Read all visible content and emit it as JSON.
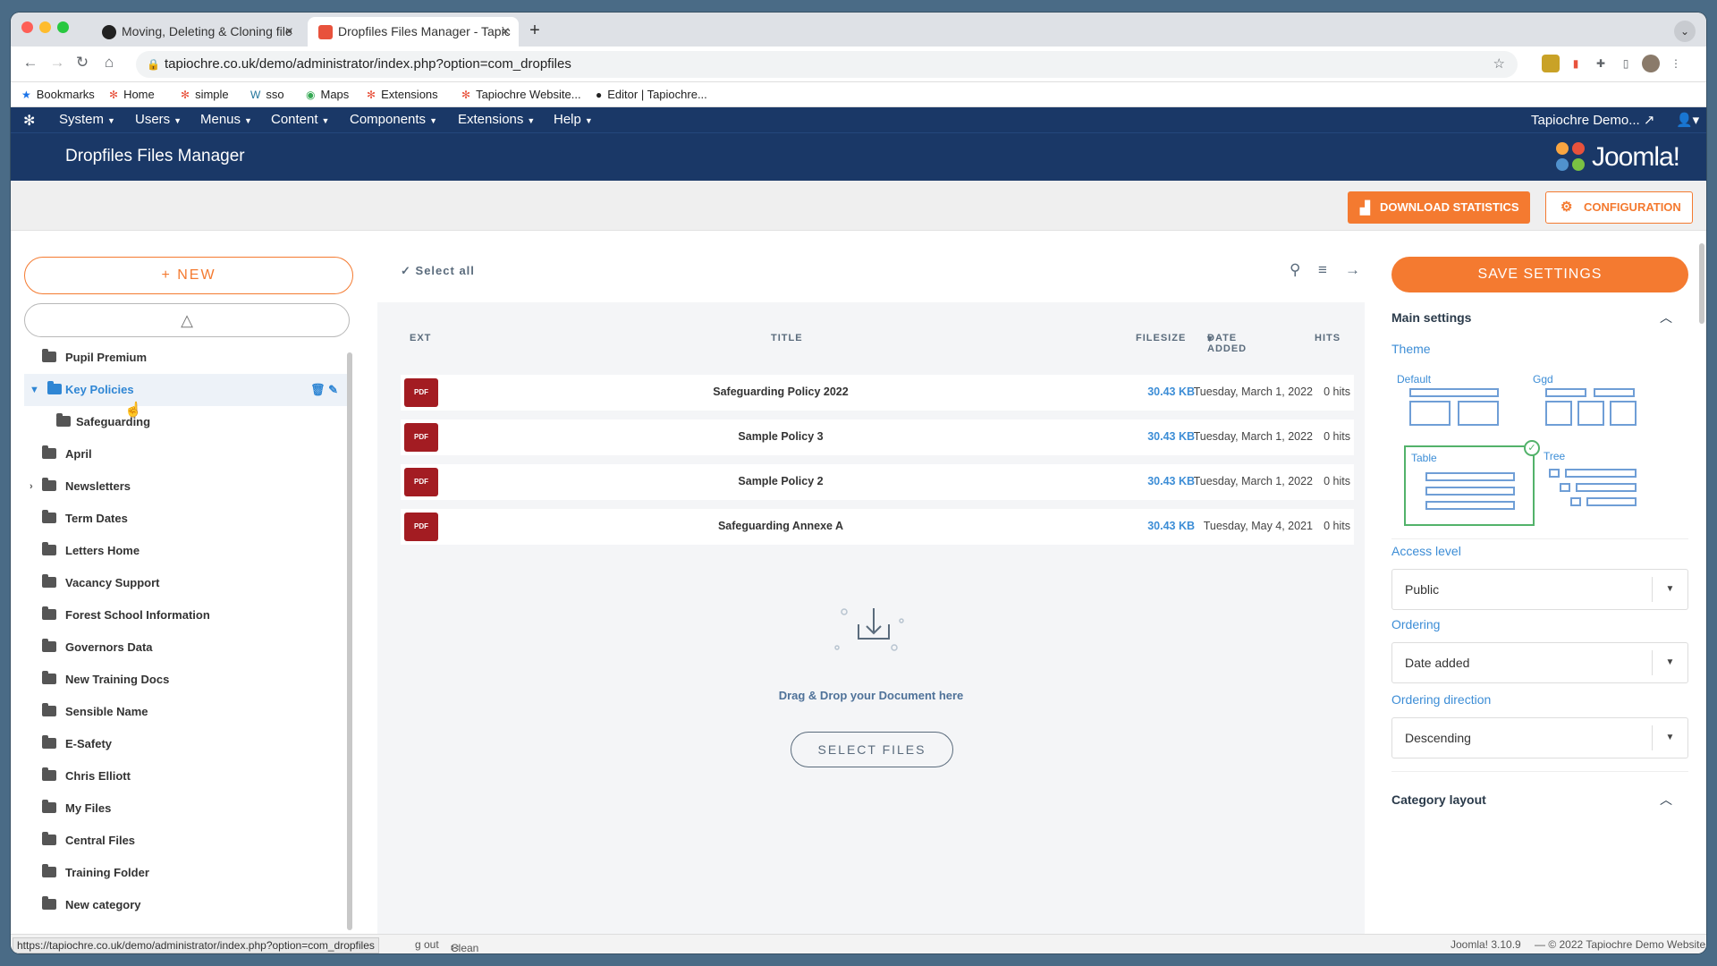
{
  "browser": {
    "tabs": [
      {
        "title": "Moving, Deleting & Cloning file"
      },
      {
        "title": "Dropfiles Files Manager - Tapic"
      }
    ],
    "new_tab": "+",
    "url": "tapiochre.co.uk/demo/administrator/index.php?option=com_dropfiles",
    "bookmarks": [
      "Bookmarks",
      "Home",
      "simple",
      "sso",
      "Maps",
      "Extensions",
      "Tapiochre Website...",
      "Editor | Tapiochre..."
    ]
  },
  "joomla_nav": {
    "items": [
      "System",
      "Users",
      "Menus",
      "Content",
      "Components",
      "Extensions",
      "Help"
    ],
    "site_link": "Tapiochre Demo..."
  },
  "header": {
    "title": "Dropfiles Files Manager",
    "logo_text": "Joomla!"
  },
  "actions": {
    "download_stats": "DOWNLOAD STATISTICS",
    "configuration": "CONFIGURATION"
  },
  "sidebar": {
    "new_label": "+ NEW",
    "drive_icon": "google-drive-icon",
    "categories": [
      {
        "label": "Pupil Premium"
      },
      {
        "label": "Key Policies"
      },
      {
        "label": "Safeguarding"
      },
      {
        "label": "April"
      },
      {
        "label": "Newsletters"
      },
      {
        "label": "Term Dates"
      },
      {
        "label": "Letters Home"
      },
      {
        "label": "Vacancy Support"
      },
      {
        "label": "Forest School Information"
      },
      {
        "label": "Governors Data"
      },
      {
        "label": "New Training Docs"
      },
      {
        "label": "Sensible Name"
      },
      {
        "label": "E-Safety"
      },
      {
        "label": "Chris Elliott"
      },
      {
        "label": "My Files"
      },
      {
        "label": "Central Files"
      },
      {
        "label": "Training Folder"
      },
      {
        "label": "New category"
      }
    ]
  },
  "files": {
    "select_all": "Select all",
    "columns": {
      "ext": "EXT",
      "title": "TITLE",
      "filesize": "FILESIZE",
      "date_added": "DATE ADDED",
      "hits": "HITS"
    },
    "rows": [
      {
        "ext": "PDF",
        "title": "Safeguarding Policy 2022",
        "size": "30.43 KB",
        "date": "Tuesday, March 1, 2022",
        "hits": "0 hits"
      },
      {
        "ext": "PDF",
        "title": "Sample Policy 3",
        "size": "30.43 KB",
        "date": "Tuesday, March 1, 2022",
        "hits": "0 hits"
      },
      {
        "ext": "PDF",
        "title": "Sample Policy 2",
        "size": "30.43 KB",
        "date": "Tuesday, March 1, 2022",
        "hits": "0 hits"
      },
      {
        "ext": "PDF",
        "title": "Safeguarding Annexe A",
        "size": "30.43 KB",
        "date": "Tuesday, May 4, 2021",
        "hits": "0 hits"
      }
    ],
    "dropzone_label": "Drag & Drop your Document here",
    "select_files": "SELECT FILES"
  },
  "settings": {
    "save": "SAVE SETTINGS",
    "main_settings": "Main settings",
    "theme_label": "Theme",
    "themes": [
      "Default",
      "Ggd",
      "Table",
      "Tree"
    ],
    "selected_theme": "Table",
    "access_level_label": "Access level",
    "access_level": "Public",
    "ordering_label": "Ordering",
    "ordering": "Date added",
    "ordering_direction_label": "Ordering direction",
    "ordering_direction": "Descending",
    "category_layout": "Category layout"
  },
  "status": {
    "hover_url": "https://tapiochre.co.uk/demo/administrator/index.php?option=com_dropfiles",
    "logout": "g out",
    "clean_cache": "Clean Cache",
    "version": "Joomla! 3.10.9",
    "copyright": "— © 2022 Tapiochre Demo Website"
  },
  "colors": {
    "brand_orange": "#f47a30",
    "joomla_navy": "#1a3867",
    "link_blue": "#3c8dd6",
    "pdf_red": "#a31c22",
    "selected_green": "#52b26a"
  }
}
